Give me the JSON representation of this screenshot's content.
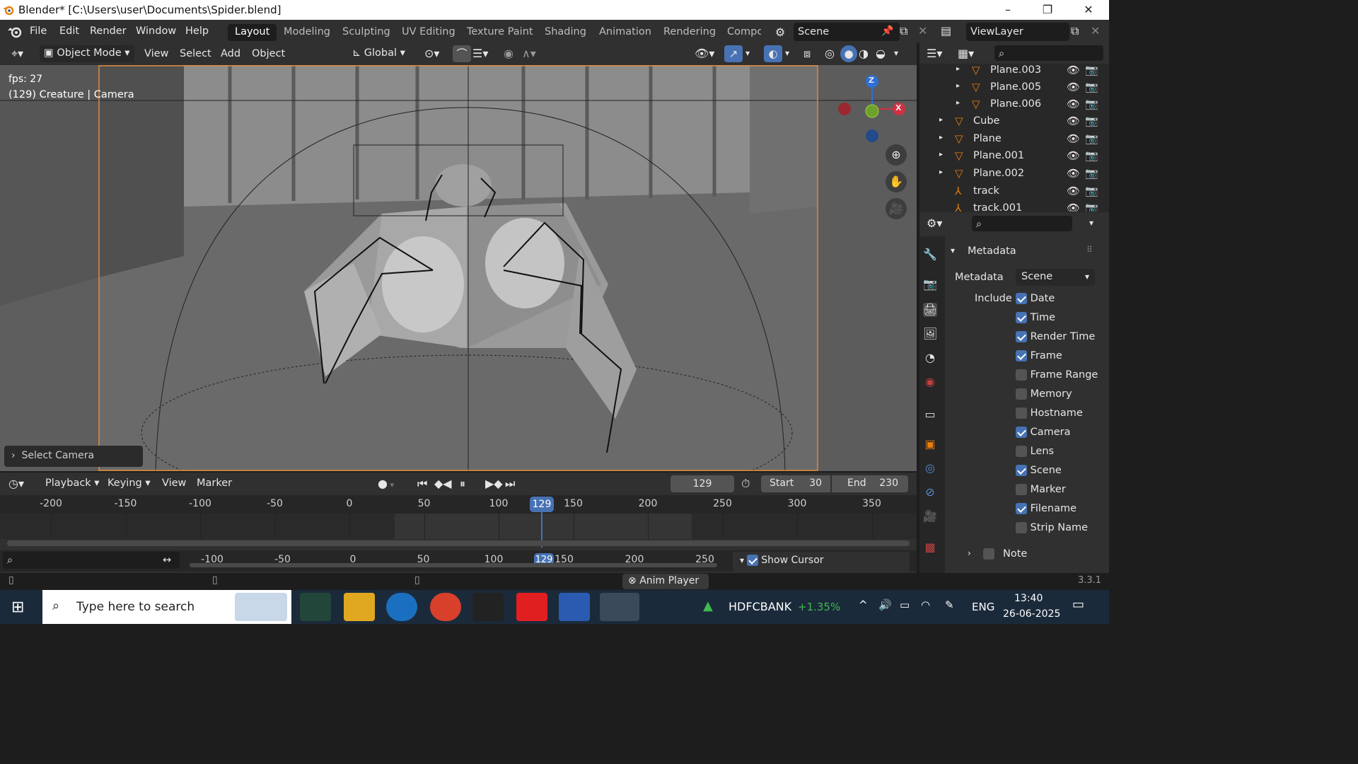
{
  "window": {
    "title": "Blender* [C:\\Users\\user\\Documents\\Spider.blend]",
    "controls": [
      "–",
      "❐",
      "✕"
    ]
  },
  "menu": [
    "File",
    "Edit",
    "Render",
    "Window",
    "Help"
  ],
  "workspaces": [
    "Layout",
    "Modeling",
    "Sculpting",
    "UV Editing",
    "Texture Paint",
    "Shading",
    "Animation",
    "Rendering",
    "Compc"
  ],
  "active_workspace": "Layout",
  "scene_name": "Scene",
  "view_layer": "ViewLayer",
  "viewport_header": {
    "mode": "Object Mode",
    "menus": [
      "View",
      "Select",
      "Add",
      "Object"
    ],
    "transform_orientation": "Global"
  },
  "viewport_overlay": {
    "fps": "fps: 27",
    "info": "(129) Creature | Camera",
    "operator_panel": "Select Camera"
  },
  "gizmo": {
    "z": "Z",
    "x": "X"
  },
  "outliner": {
    "items": [
      {
        "name": "Plane.003",
        "indent": 2
      },
      {
        "name": "Plane.005",
        "indent": 2
      },
      {
        "name": "Plane.006",
        "indent": 2
      },
      {
        "name": "Cube",
        "indent": 1
      },
      {
        "name": "Plane",
        "indent": 1
      },
      {
        "name": "Plane.001",
        "indent": 1
      },
      {
        "name": "Plane.002",
        "indent": 1
      },
      {
        "name": "track",
        "indent": 1
      },
      {
        "name": "track.001",
        "indent": 1
      }
    ]
  },
  "properties": {
    "panel_title": "Metadata",
    "metadata_label": "Metadata",
    "metadata_value": "Scene",
    "include_label": "Include",
    "include": [
      {
        "label": "Date",
        "checked": true
      },
      {
        "label": "Time",
        "checked": true
      },
      {
        "label": "Render Time",
        "checked": true
      },
      {
        "label": "Frame",
        "checked": true
      },
      {
        "label": "Frame Range",
        "checked": false
      },
      {
        "label": "Memory",
        "checked": false
      },
      {
        "label": "Hostname",
        "checked": false
      },
      {
        "label": "Camera",
        "checked": true
      },
      {
        "label": "Lens",
        "checked": false
      },
      {
        "label": "Scene",
        "checked": true
      },
      {
        "label": "Marker",
        "checked": false
      },
      {
        "label": "Filename",
        "checked": true
      },
      {
        "label": "Strip Name",
        "checked": false
      }
    ],
    "note_label": "Note"
  },
  "timeline": {
    "menus": [
      "Playback",
      "Keying",
      "View",
      "Marker"
    ],
    "current_frame": "129",
    "start_label": "Start",
    "start": "30",
    "end_label": "End",
    "end": "230",
    "ruler": [
      "-200",
      "-150",
      "-100",
      "-50",
      "0",
      "50",
      "100",
      "150",
      "200",
      "250",
      "300",
      "350"
    ],
    "ruler2": [
      "-100",
      "-50",
      "0",
      "50",
      "100",
      "150",
      "200",
      "250"
    ],
    "show_cursor": "Show Cursor"
  },
  "statusbar": {
    "notice": "Anim Player",
    "version": "3.3.1"
  },
  "taskbar": {
    "search_placeholder": "Type here to search",
    "stock_name": "HDFCBANK",
    "stock_change": "+1.35%",
    "language": "ENG",
    "time": "13:40",
    "date": "26-06-2025"
  },
  "colors": {
    "accent": "#4772b3",
    "panel": "#303030",
    "viewport": "#5e5e5e",
    "orange": "#e87d0d",
    "stock_green": "#3fb950"
  }
}
